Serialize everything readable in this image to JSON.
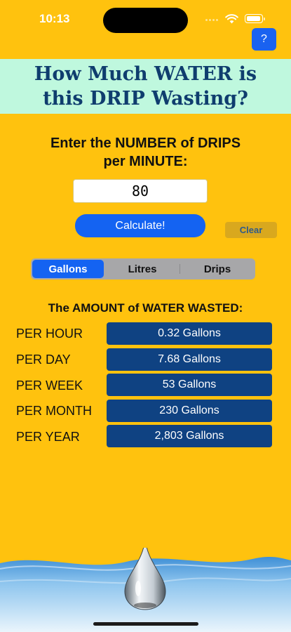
{
  "status_bar": {
    "time": "10:13"
  },
  "help_button": {
    "label": "?"
  },
  "title": {
    "line1": "How Much WATER is",
    "line2": "this DRIP Wasting?"
  },
  "prompt": {
    "line1": "Enter the NUMBER of DRIPS",
    "line2": "per MINUTE:"
  },
  "drips_input": {
    "value": "80"
  },
  "calculate_button": {
    "label": "Calculate!"
  },
  "clear_button": {
    "label": "Clear"
  },
  "unit_selector": {
    "options": [
      "Gallons",
      "Litres",
      "Drips"
    ],
    "selected": "Gallons"
  },
  "results": {
    "header": "The AMOUNT of WATER WASTED:",
    "rows": [
      {
        "label": "PER HOUR",
        "value": "0.32 Gallons"
      },
      {
        "label": "PER DAY",
        "value": "7.68 Gallons"
      },
      {
        "label": "PER WEEK",
        "value": "53 Gallons"
      },
      {
        "label": "PER MONTH",
        "value": "230 Gallons"
      },
      {
        "label": "PER YEAR",
        "value": "2,803 Gallons"
      }
    ]
  },
  "colors": {
    "background": "#FFC20E",
    "banner": "#BFF8DE",
    "title_text": "#0F3D6E",
    "accent_blue": "#1463F2",
    "result_box": "#0F4282",
    "clear_button": "#D9A81E"
  },
  "icons": [
    "wifi-icon",
    "battery-icon",
    "water-drop-icon"
  ]
}
